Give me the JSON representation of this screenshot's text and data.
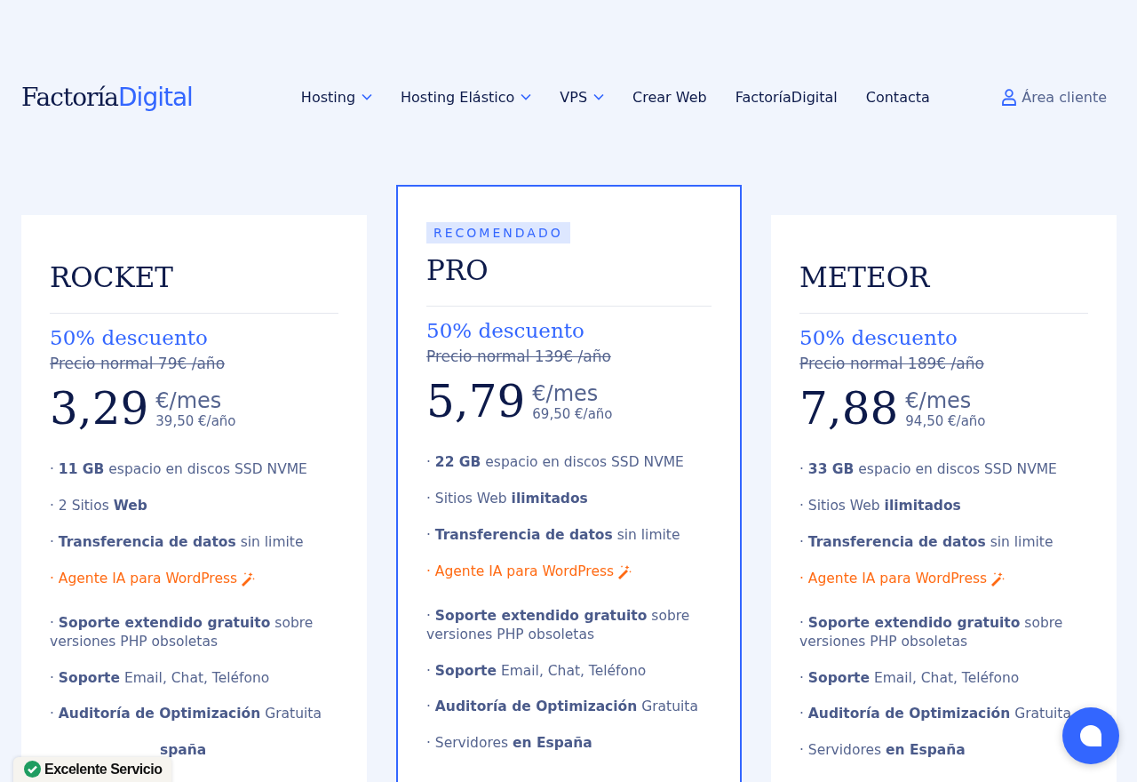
{
  "header": {
    "logo": {
      "part_1": "Factoría",
      "part_2": "Digital"
    },
    "nav": [
      {
        "label": "Hosting",
        "dropdown": true
      },
      {
        "label": "Hosting Elástico",
        "dropdown": true
      },
      {
        "label": "VPS",
        "dropdown": true
      },
      {
        "label": "Crear Web",
        "dropdown": false
      },
      {
        "label": "FactoríaDigital",
        "dropdown": false
      },
      {
        "label": "Contacta",
        "dropdown": false
      }
    ],
    "account_link": "Área cliente"
  },
  "plans": [
    {
      "name": "ROCKET",
      "recommended": false,
      "discount": "50% descuento",
      "normal_price": "Precio normal 79€ /año",
      "price": "3,29",
      "unit": "€/mes",
      "yearly": "39,50 €/año",
      "features": [
        {
          "kind": "plain",
          "text": "· **11 GB** espacio en discos SSD NVME"
        },
        {
          "kind": "plain",
          "text": "· 2 Sitios **Web**"
        },
        {
          "kind": "plain",
          "text": "· **Transferencia de datos** sin limite"
        },
        {
          "kind": "promo",
          "text": "· Agente IA para WordPress"
        },
        {
          "kind": "plain",
          "text": "· **Soporte extendido gratuito** sobre versiones PHP obsoletas"
        },
        {
          "kind": "plain",
          "text": "· **Soporte** Email, Chat, Teléfono"
        },
        {
          "kind": "plain",
          "text": "· **Auditoría de Optimización** Gratuita"
        },
        {
          "kind": "covered",
          "text": "**spaña**"
        }
      ]
    },
    {
      "name": "PRO",
      "recommended": true,
      "badge": "RECOMENDADO",
      "discount": "50% descuento",
      "normal_price": "Precio normal 139€ /año",
      "price": "5,79",
      "unit": "€/mes",
      "yearly": "69,50 €/año",
      "features": [
        {
          "kind": "plain",
          "text": "· **22 GB** espacio en discos SSD NVME"
        },
        {
          "kind": "plain",
          "text": "· Sitios Web **ilimitados**"
        },
        {
          "kind": "plain",
          "text": "· **Transferencia de datos** sin limite"
        },
        {
          "kind": "promo",
          "text": "· Agente IA para WordPress"
        },
        {
          "kind": "plain",
          "text": "· **Soporte extendido gratuito** sobre versiones PHP obsoletas"
        },
        {
          "kind": "plain",
          "text": "· **Soporte** Email, Chat, Teléfono"
        },
        {
          "kind": "plain",
          "text": "· **Auditoría de Optimización** Gratuita"
        },
        {
          "kind": "plain",
          "text": "· Servidores **en España**"
        }
      ]
    },
    {
      "name": "METEOR",
      "recommended": false,
      "discount": "50% descuento",
      "normal_price": "Precio normal 189€ /año",
      "price": "7,88",
      "unit": "€/mes",
      "yearly": "94,50 €/año",
      "features": [
        {
          "kind": "plain",
          "text": "· **33 GB** espacio en discos SSD NVME"
        },
        {
          "kind": "plain",
          "text": "· Sitios Web **ilimitados**"
        },
        {
          "kind": "plain",
          "text": "· **Transferencia de datos** sin limite"
        },
        {
          "kind": "promo",
          "text": "· Agente IA para WordPress"
        },
        {
          "kind": "plain",
          "text": "· **Soporte extendido gratuito** sobre versiones PHP obsoletas"
        },
        {
          "kind": "plain",
          "text": "· **Soporte** Email, Chat, Teléfono"
        },
        {
          "kind": "plain",
          "text": "· **Auditoría de Optimización** Gratuita"
        },
        {
          "kind": "plain",
          "text": "· Servidores **en España**"
        }
      ]
    }
  ],
  "trust_badge": "Excelente Servicio"
}
